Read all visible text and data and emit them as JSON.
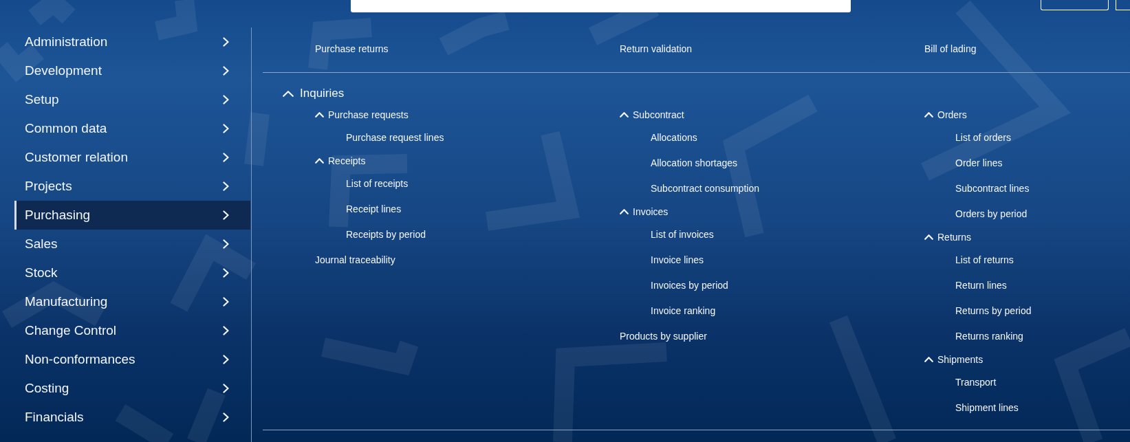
{
  "sidebar": {
    "items": [
      {
        "label": "Administration",
        "selected": false
      },
      {
        "label": "Development",
        "selected": false
      },
      {
        "label": "Setup",
        "selected": false
      },
      {
        "label": "Common data",
        "selected": false
      },
      {
        "label": "Customer relation",
        "selected": false
      },
      {
        "label": "Projects",
        "selected": false
      },
      {
        "label": "Purchasing",
        "selected": true
      },
      {
        "label": "Sales",
        "selected": false
      },
      {
        "label": "Stock",
        "selected": false
      },
      {
        "label": "Manufacturing",
        "selected": false
      },
      {
        "label": "Change Control",
        "selected": false
      },
      {
        "label": "Non-conformances",
        "selected": false
      },
      {
        "label": "Costing",
        "selected": false
      },
      {
        "label": "Financials",
        "selected": false
      }
    ]
  },
  "menu": {
    "top_links": [
      "Purchase returns",
      "Return validation",
      "Bill of lading"
    ],
    "sections": [
      {
        "title": "Inquiries",
        "expanded": true,
        "columns": [
          {
            "items": [
              {
                "kind": "group",
                "label": "Purchase requests",
                "expanded": true,
                "children": [
                  {
                    "label": "Purchase request lines"
                  }
                ]
              },
              {
                "kind": "group",
                "label": "Receipts",
                "expanded": true,
                "children": [
                  {
                    "label": "List of receipts"
                  },
                  {
                    "label": "Receipt lines"
                  },
                  {
                    "label": "Receipts by period"
                  }
                ]
              },
              {
                "kind": "link",
                "label": "Journal traceability"
              }
            ]
          },
          {
            "items": [
              {
                "kind": "group",
                "label": "Subcontract",
                "expanded": true,
                "children": [
                  {
                    "label": "Allocations"
                  },
                  {
                    "label": "Allocation shortages"
                  },
                  {
                    "label": "Subcontract consumption"
                  }
                ]
              },
              {
                "kind": "group",
                "label": "Invoices",
                "expanded": true,
                "children": [
                  {
                    "label": "List of invoices"
                  },
                  {
                    "label": "Invoice lines"
                  },
                  {
                    "label": "Invoices by period"
                  },
                  {
                    "label": "Invoice ranking"
                  }
                ]
              },
              {
                "kind": "link",
                "label": "Products by supplier"
              }
            ]
          },
          {
            "items": [
              {
                "kind": "group",
                "label": "Orders",
                "expanded": true,
                "children": [
                  {
                    "label": "List of orders"
                  },
                  {
                    "label": "Order lines"
                  },
                  {
                    "label": "Subcontract lines"
                  },
                  {
                    "label": "Orders by period"
                  }
                ]
              },
              {
                "kind": "group",
                "label": "Returns",
                "expanded": true,
                "children": [
                  {
                    "label": "List of returns"
                  },
                  {
                    "label": "Return lines"
                  },
                  {
                    "label": "Returns by period"
                  },
                  {
                    "label": "Returns ranking"
                  }
                ]
              },
              {
                "kind": "group",
                "label": "Shipments",
                "expanded": true,
                "children": [
                  {
                    "label": "Transport"
                  },
                  {
                    "label": "Shipment lines"
                  }
                ]
              }
            ]
          }
        ]
      }
    ]
  }
}
